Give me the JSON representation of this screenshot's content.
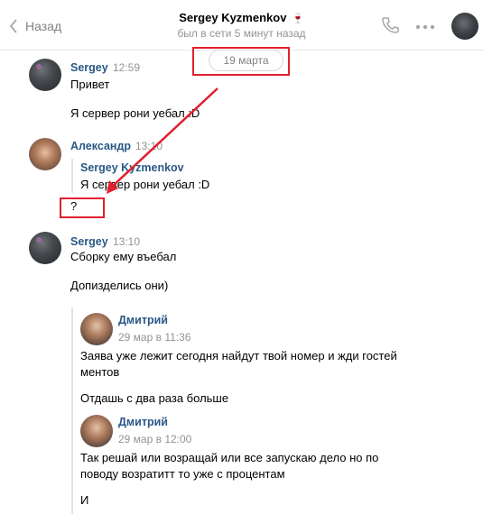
{
  "header": {
    "back_label": "Назад",
    "title": "Sergey Kyzmenkov",
    "title_emoji": "🍷",
    "subtitle": "был в сети 5 минут назад"
  },
  "date_divider": "19 марта",
  "messages": [
    {
      "author": "Sergey",
      "time": "12:59",
      "lines": [
        "Привет",
        "Я сервер рони уебал :D"
      ]
    },
    {
      "author": "Александр",
      "time": "13:10",
      "reply": {
        "author": "Sergey Kyzmenkov",
        "text": "Я сервер рони уебал :D"
      },
      "lines": [
        "?"
      ]
    },
    {
      "author": "Sergey",
      "time": "13:10",
      "lines": [
        "Сборку ему въебал",
        "Допизделись они)"
      ],
      "forwarded": [
        {
          "author": "Дмитрий",
          "date": "29 мар в 11:36",
          "lines": [
            "Заява уже лежит сегодня найдут твой номер и жди гостей",
            "ментов",
            "Отдашь с два раза больше"
          ]
        },
        {
          "author": "Дмитрий",
          "date": "29 мар в 12:00",
          "lines": [
            "Так решай или возращай или все запускаю дело но по",
            "поводу возратитт то уже с процентам",
            "И"
          ]
        }
      ]
    }
  ],
  "colors": {
    "link": "#2a5885",
    "muted": "#939393",
    "annotation": "#e0202f"
  }
}
